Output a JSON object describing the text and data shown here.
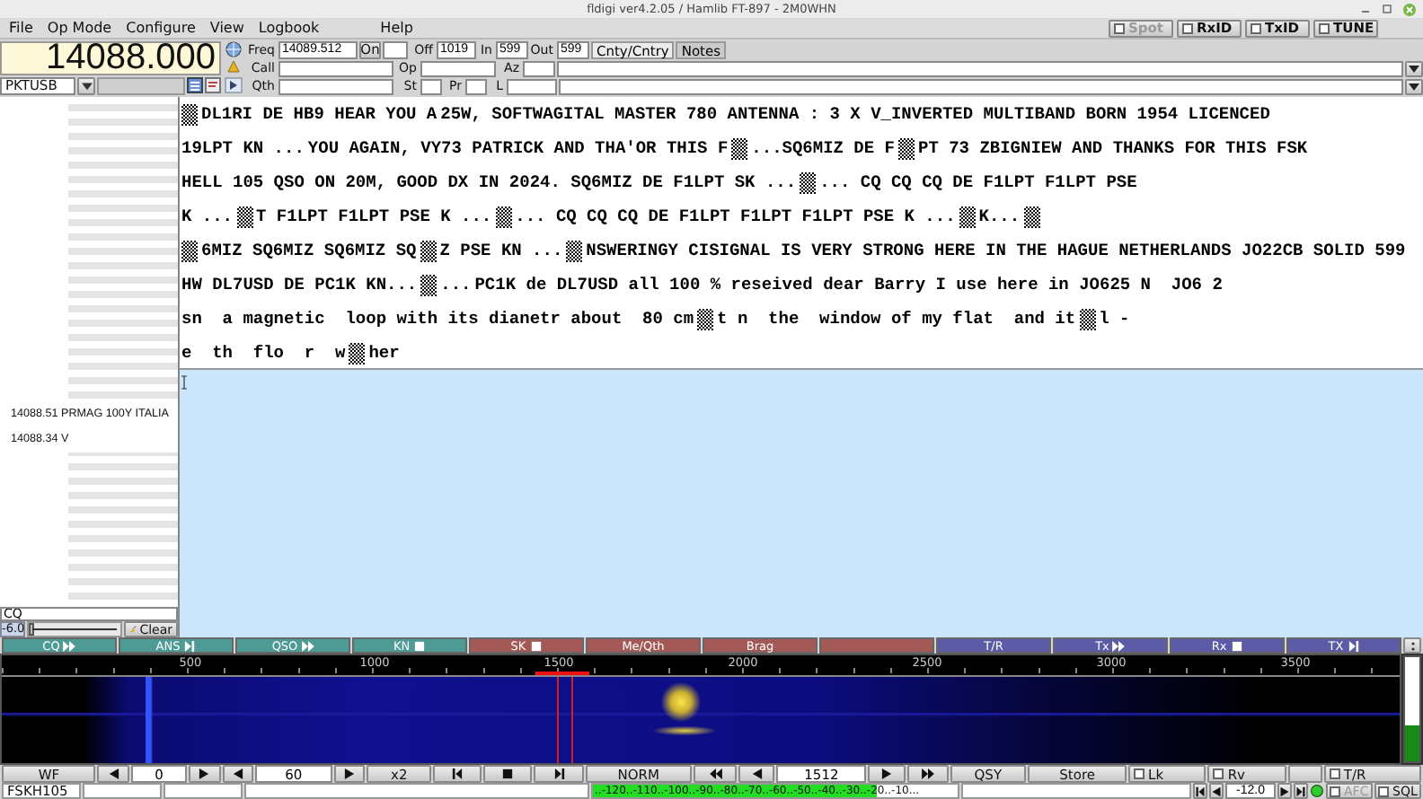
{
  "window": {
    "title": "fldigi ver4.2.05 / Hamlib FT-897 - 2M0WHN"
  },
  "menu": [
    "File",
    "Op Mode",
    "Configure",
    "View",
    "Logbook",
    "Help"
  ],
  "toggles": [
    {
      "label": "Spot",
      "checked": false,
      "disabled": true
    },
    {
      "label": "RxID",
      "checked": false,
      "disabled": false
    },
    {
      "label": "TxID",
      "checked": false,
      "disabled": false
    },
    {
      "label": "TUNE",
      "checked": false,
      "disabled": false
    }
  ],
  "rig": {
    "frequency": "14088.000",
    "mode": "PKTUSB"
  },
  "log": {
    "rows": [
      {
        "fields": [
          {
            "kind": "field",
            "label": "Freq",
            "value": "14089.512"
          },
          {
            "kind": "button",
            "label": "On"
          },
          {
            "kind": "field"
          },
          {
            "kind": "field",
            "label": "Off",
            "value": "1019"
          },
          {
            "kind": "field",
            "label": "In",
            "value": "599"
          },
          {
            "kind": "field",
            "label": "Out",
            "value": "599"
          }
        ]
      },
      {
        "fields": [
          {
            "kind": "field",
            "label": "Call"
          },
          {
            "kind": "field",
            "label": "Op"
          },
          {
            "kind": "field",
            "label": "Az"
          },
          {
            "kind": "combo"
          }
        ]
      },
      {
        "fields": [
          {
            "kind": "field",
            "label": "Qth"
          },
          {
            "kind": "field",
            "label": "St"
          },
          {
            "kind": "field",
            "label": "Pr"
          },
          {
            "kind": "field",
            "label": "L"
          },
          {
            "kind": "combo"
          }
        ]
      }
    ],
    "tabs": [
      {
        "label": "Cnty/Cntry",
        "selected": true
      },
      {
        "label": "Notes",
        "selected": false
      }
    ]
  },
  "left_panel": {
    "entries": [
      "14088.51 PRMAG 100Y ITALIA",
      "14088.34 V"
    ],
    "search": {
      "value": "CQ"
    },
    "gain": {
      "reading": "-6.0",
      "level": 0.0
    },
    "clear_button": "Clear"
  },
  "rx_text": [
    {
      "parts": [
        {
          "kind": "noise"
        },
        {
          "kind": "text",
          "text": "DL1RI DE HB9 HEAR YOU A"
        },
        {
          "kind": "text",
          "text": "25W, SOFTWAGITAL MASTER 780 ANTENNA : 3 X V_INVERTED MULTIBAND BORN 1954 LICENCED"
        }
      ]
    },
    {
      "parts": [
        {
          "kind": "text",
          "text": "19LPT KN ..."
        },
        {
          "kind": "text",
          "text": "YOU AGAIN, VY73 PATRICK AND THA'OR THIS F"
        },
        {
          "kind": "noise"
        },
        {
          "kind": "text",
          "text": "...SQ6MIZ DE F"
        },
        {
          "kind": "noise"
        },
        {
          "kind": "text",
          "text": "PT 73 ZBIGNIEW AND THANKS FOR THIS FSK"
        }
      ]
    },
    {
      "parts": [
        {
          "kind": "text",
          "text": "HELL 105 QSO ON 20M, GOOD DX IN 2024. SQ6MIZ DE F1LPT SK ..."
        },
        {
          "kind": "noise"
        },
        {
          "kind": "text",
          "text": "... CQ CQ CQ DE F1LPT F1LPT PSE"
        }
      ]
    },
    {
      "parts": [
        {
          "kind": "text",
          "text": "K ..."
        },
        {
          "kind": "noise"
        },
        {
          "kind": "text",
          "text": "T F1LPT F1LPT PSE K ..."
        },
        {
          "kind": "noise"
        },
        {
          "kind": "text",
          "text": "... CQ CQ CQ DE F1LPT F1LPT F1LPT PSE K ..."
        },
        {
          "kind": "noise"
        },
        {
          "kind": "text",
          "text": "K..."
        },
        {
          "kind": "noise"
        }
      ]
    },
    {
      "parts": [
        {
          "kind": "noise"
        },
        {
          "kind": "text",
          "text": "6MIZ SQ6MIZ SQ6MIZ SQ"
        },
        {
          "kind": "noise"
        },
        {
          "kind": "text",
          "text": "Z PSE KN ..."
        },
        {
          "kind": "noise"
        },
        {
          "kind": "text",
          "text": "NSWERINGY CISIGNAL IS VERY STRONG HERE IN THE HAGUE NETHERLANDS JO22CB SOLID 599"
        }
      ]
    },
    {
      "parts": [
        {
          "kind": "text",
          "text": "HW DL7USD DE PC1K KN..."
        },
        {
          "kind": "noise"
        },
        {
          "kind": "text",
          "text": "..."
        },
        {
          "kind": "text",
          "text": "PC1K de DL7USD all 100 % reseived dear Barry I use here in JO625 N  JO6 2"
        }
      ]
    },
    {
      "parts": [
        {
          "kind": "text",
          "text": "sn  a magnetic  loop with its dianetr about  80 cm"
        },
        {
          "kind": "noise"
        },
        {
          "kind": "text",
          "text": "t n  the  window of my flat  and it"
        },
        {
          "kind": "noise"
        },
        {
          "kind": "text",
          "text": "l -"
        }
      ]
    },
    {
      "parts": [
        {
          "kind": "text",
          "text": "e  th  flo  r  w"
        },
        {
          "kind": "noise"
        },
        {
          "kind": "text",
          "text": "her"
        }
      ]
    }
  ],
  "macros": [
    {
      "label": "CQ",
      "color": "#4e9a94"
    },
    {
      "label": "ANS",
      "color": "#4e9a94"
    },
    {
      "label": "QSO",
      "color": "#4e9a94"
    },
    {
      "label": "KN",
      "color": "#4e9a94"
    },
    {
      "label": "SK",
      "color": "#a35a57"
    },
    {
      "label": "Me/Qth",
      "color": "#a35a57"
    },
    {
      "label": "Brag",
      "color": "#a35a57"
    },
    {
      "color": "#a35a57"
    },
    {
      "label": "T/R",
      "color": "#5b5ba6"
    },
    {
      "label": "Tx",
      "color": "#5b5ba6"
    },
    {
      "label": "Rx",
      "color": "#5b5ba6"
    },
    {
      "label": "TX",
      "color": "#5b5ba6"
    }
  ],
  "waterfall": {
    "scale": [
      "500",
      "1000",
      "1500",
      "2000",
      "2500",
      "3000",
      "3500"
    ],
    "meter": {
      "level": 0.35
    }
  },
  "controls": [
    {
      "kind": "button",
      "label": "WF"
    },
    {
      "kind": "left"
    },
    {
      "kind": "field",
      "value": "0"
    },
    {
      "kind": "right"
    },
    {
      "kind": "left"
    },
    {
      "kind": "field",
      "value": "60"
    },
    {
      "kind": "right"
    },
    {
      "kind": "button",
      "label": "x2"
    },
    {
      "kind": "step-left"
    },
    {
      "kind": "stop"
    },
    {
      "kind": "step-right"
    },
    {
      "kind": "button",
      "label": "NORM"
    },
    {
      "kind": "fast-left"
    },
    {
      "kind": "left"
    },
    {
      "kind": "field",
      "value": "1512"
    },
    {
      "kind": "right"
    },
    {
      "kind": "fast-right"
    },
    {
      "kind": "button",
      "label": "QSY"
    },
    {
      "kind": "button",
      "label": "Store"
    },
    {
      "kind": "check",
      "label": "Lk",
      "checked": false
    },
    {
      "kind": "check",
      "label": "Rv",
      "checked": false
    },
    {
      "kind": "button"
    },
    {
      "kind": "check",
      "label": "T/R",
      "checked": false
    }
  ],
  "status": {
    "mode": "FSKH105",
    "signal": {
      "scale": "..-120..-110..-100..-90..-80..-70..-60..-50..-40..-30..-20..-10...",
      "level": 0.78
    },
    "squelch": "-12.0",
    "led": {
      "on": true
    },
    "afc": {
      "label": "AFC",
      "checked": false,
      "disabled": true
    },
    "sql": {
      "label": "SQL",
      "checked": false
    }
  }
}
